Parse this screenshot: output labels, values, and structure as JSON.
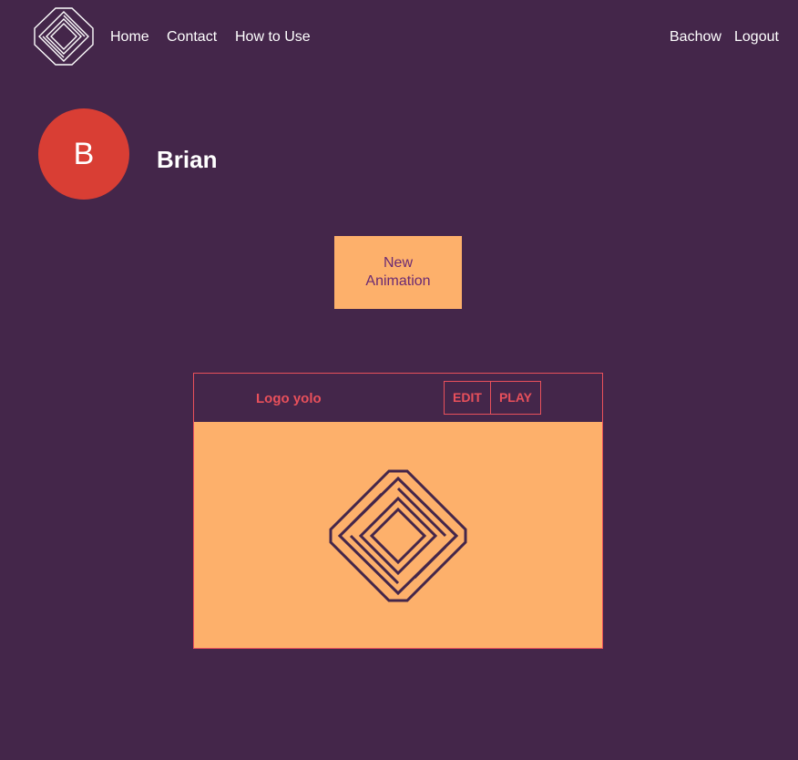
{
  "nav": {
    "logo_icon": "diamond-logo-icon",
    "links": [
      {
        "label": "Home"
      },
      {
        "label": "Contact"
      },
      {
        "label": "How to Use"
      }
    ],
    "user_link": "Bachow",
    "logout_link": "Logout"
  },
  "profile": {
    "avatar_letter": "B",
    "avatar_color": "#d93e34",
    "name": "Brian"
  },
  "new_animation_button": "New Animation",
  "animations": [
    {
      "title": "Logo yolo",
      "edit_label": "EDIT",
      "play_label": "PLAY",
      "preview_icon": "diamond-logo-icon"
    }
  ],
  "colors": {
    "background": "#44264a",
    "accent": "#fdb06b",
    "card_border": "#e8505b",
    "button_text": "#6b2a73"
  }
}
